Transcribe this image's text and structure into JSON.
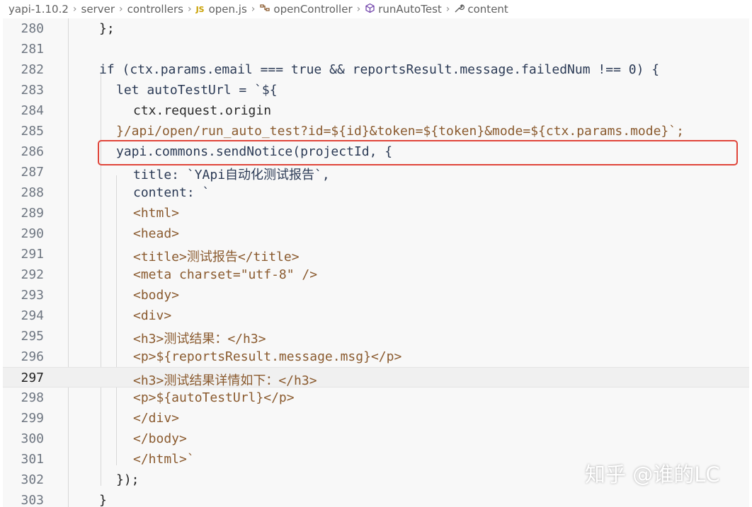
{
  "breadcrumb": {
    "root": "yapi-1.10.2",
    "folder1": "server",
    "folder2": "controllers",
    "file_badge": "JS",
    "file": "open.js",
    "class_name": "openController",
    "method": "runAutoTest",
    "property": "content"
  },
  "editor": {
    "active_line": "297",
    "lines": [
      {
        "num": "280",
        "text": "};"
      },
      {
        "num": "281",
        "text": ""
      },
      {
        "num": "282",
        "text": "if (ctx.params.email === true && reportsResult.message.failedNum !== 0) {"
      },
      {
        "num": "283",
        "text": "let autoTestUrl = `${"
      },
      {
        "num": "284",
        "text": "ctx.request.origin"
      },
      {
        "num": "285",
        "text": "}/api/open/run_auto_test?id=${id}&token=${token}&mode=${ctx.params.mode}`;"
      },
      {
        "num": "286",
        "text": "yapi.commons.sendNotice(projectId, {"
      },
      {
        "num": "287",
        "text": "title: `YApi自动化测试报告`,"
      },
      {
        "num": "288",
        "text": "content: `"
      },
      {
        "num": "289",
        "text": "<html>"
      },
      {
        "num": "290",
        "text": "<head>"
      },
      {
        "num": "291",
        "text": "<title>测试报告</title>"
      },
      {
        "num": "292",
        "text": "<meta charset=\"utf-8\" />"
      },
      {
        "num": "293",
        "text": "<body>"
      },
      {
        "num": "294",
        "text": "<div>"
      },
      {
        "num": "295",
        "text": "<h3>测试结果：</h3>"
      },
      {
        "num": "296",
        "text": "<p>${reportsResult.message.msg}</p>"
      },
      {
        "num": "297",
        "text": "<h3>测试结果详情如下：</h3>"
      },
      {
        "num": "298",
        "text": "<p>${autoTestUrl}</p>"
      },
      {
        "num": "299",
        "text": "</div>"
      },
      {
        "num": "300",
        "text": "</body>"
      },
      {
        "num": "301",
        "text": "</html>`"
      },
      {
        "num": "302",
        "text": "});"
      },
      {
        "num": "303",
        "text": "}"
      }
    ]
  },
  "watermark": "知乎 @谁的LC",
  "colors": {
    "keyword": "#3b69b6",
    "string": "#8a5a2e",
    "number": "#097b5e",
    "highlight_border": "#e0453a"
  }
}
